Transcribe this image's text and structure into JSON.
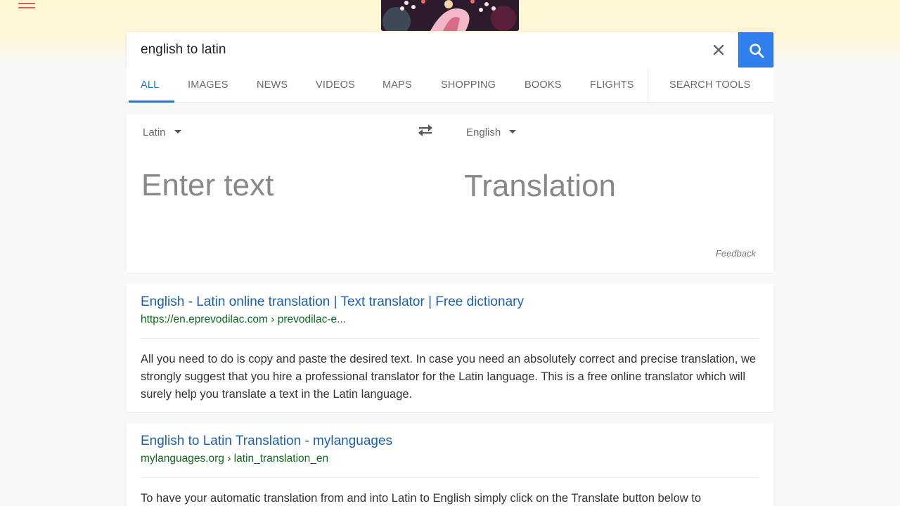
{
  "search": {
    "query": "english to latin",
    "clear_icon": "close-icon",
    "search_icon": "search-icon"
  },
  "tabs": [
    {
      "label": "ALL",
      "active": true
    },
    {
      "label": "IMAGES"
    },
    {
      "label": "NEWS"
    },
    {
      "label": "VIDEOS"
    },
    {
      "label": "MAPS"
    },
    {
      "label": "SHOPPING"
    },
    {
      "label": "BOOKS"
    },
    {
      "label": "FLIGHTS"
    },
    {
      "label": "SEARCH TOOLS"
    }
  ],
  "translate": {
    "source_lang": "Latin",
    "target_lang": "English",
    "source_placeholder": "Enter text",
    "translation_placeholder": "Translation",
    "feedback": "Feedback",
    "swap_icon": "swap-arrows-icon"
  },
  "results": [
    {
      "title": "English - Latin online translation | Text translator | Free dictionary",
      "url": "https://en.eprevodilac.com › prevodilac-e...",
      "snippet": "All you need to do is copy and paste the desired text. In case you need an absolutely correct and precise translation, we strongly suggest that you hire a professional translator for the Latin language. This is a free online translator which will surely help you translate a text in the Latin language."
    },
    {
      "title": "English to Latin Translation - mylanguages",
      "url": "mylanguages.org › latin_translation_en",
      "snippet": "To have your automatic translation from and into Latin to English simply click on the Translate button below to"
    }
  ],
  "colors": {
    "accent": "#1a73e8",
    "search_button": "#2f7fed",
    "link": "#1a5fb4",
    "url": "#0e6b1e",
    "menu": "#e0555b"
  }
}
